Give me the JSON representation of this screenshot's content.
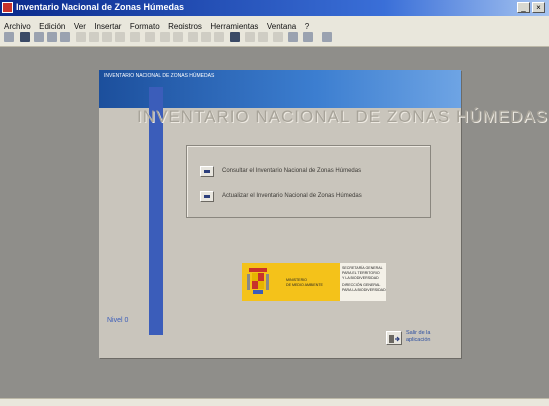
{
  "window": {
    "title": "Inventario Nacional de Zonas Húmedas",
    "controls": {
      "minimize": "_",
      "close": "×"
    }
  },
  "menubar": {
    "items": [
      "Archivo",
      "Edición",
      "Ver",
      "Insertar",
      "Formato",
      "Registros",
      "Herramientas",
      "Ventana",
      "?"
    ]
  },
  "form": {
    "caption": "INVENTARIO NACIONAL DE ZONAS HÚMEDAS",
    "title": "INVENTARIO NACIONAL DE ZONAS HÚMEDAS",
    "options": [
      {
        "label": "Consultar el Inventario Nacional de Zonas Húmedas"
      },
      {
        "label": "Actualizar el Inventario Nacional de Zonas Húmedas"
      }
    ],
    "level": "Nivel 0",
    "exit": {
      "line1": "Salir de la",
      "line2": "aplicación"
    }
  },
  "logo": {
    "ministry_line1": "MINISTERIO",
    "ministry_line2": "DE MEDIO AMBIENTE",
    "right_lines": [
      "SECRETARÍA GENERAL",
      "PARA EL TERRITORIO",
      "Y LA BIODIVERSIDAD",
      "DIRECCIÓN GENERAL",
      "PARA LA BIODIVERSIDAD"
    ]
  },
  "colors": {
    "accent_blue": "#3b5dba",
    "header_blue": "#1c4f9c",
    "logo_yellow": "#f4c21a",
    "workspace_gray": "#8f8e8a"
  }
}
